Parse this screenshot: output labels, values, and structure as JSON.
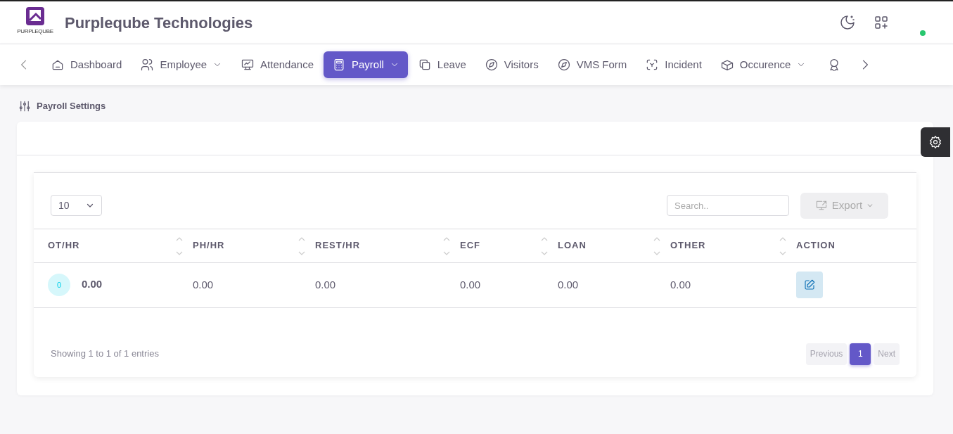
{
  "header": {
    "logo_text": "PURPLEQUBE",
    "title": "Purpleqube Technologies",
    "online": true
  },
  "nav": {
    "items": [
      {
        "label": "Dashboard",
        "selected": false,
        "dropdown": false
      },
      {
        "label": "Employee",
        "selected": false,
        "dropdown": true
      },
      {
        "label": "Attendance",
        "selected": false,
        "dropdown": false
      },
      {
        "label": "Payroll",
        "selected": true,
        "dropdown": true
      },
      {
        "label": "Leave",
        "selected": false,
        "dropdown": false
      },
      {
        "label": "Visitors",
        "selected": false,
        "dropdown": false
      },
      {
        "label": "VMS Form",
        "selected": false,
        "dropdown": false
      },
      {
        "label": "Incident",
        "selected": false,
        "dropdown": false
      },
      {
        "label": "Occurence",
        "selected": false,
        "dropdown": true
      }
    ]
  },
  "breadcrumb": "Payroll Settings",
  "table_controls": {
    "page_size": "10",
    "search_placeholder": "Search..",
    "export_label": "Export"
  },
  "table": {
    "columns": [
      {
        "label": "OT/HR",
        "sortable": true
      },
      {
        "label": "PH/HR",
        "sortable": true
      },
      {
        "label": "REST/HR",
        "sortable": true
      },
      {
        "label": "ECF",
        "sortable": true
      },
      {
        "label": "LOAN",
        "sortable": true
      },
      {
        "label": "OTHER",
        "sortable": true
      },
      {
        "label": "ACTION",
        "sortable": false
      }
    ],
    "rows": [
      {
        "avatar": "0",
        "cells": [
          "0.00",
          "0.00",
          "0.00",
          "0.00",
          "0.00",
          "0.00"
        ]
      }
    ]
  },
  "footer": {
    "info": "Showing 1 to 1 of 1 entries",
    "pages": [
      {
        "label": "Previous",
        "selected": false,
        "disabled": true
      },
      {
        "label": "1",
        "selected": true,
        "disabled": false
      },
      {
        "label": "Next",
        "selected": false,
        "disabled": true
      }
    ]
  }
}
